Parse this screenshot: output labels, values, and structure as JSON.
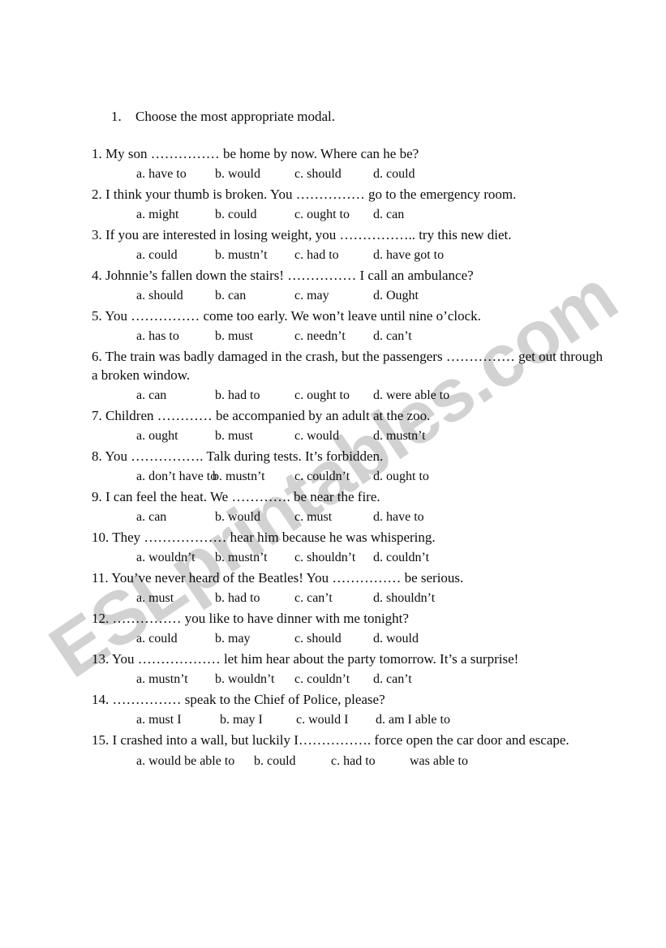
{
  "document": {
    "instruction_number": "1.",
    "instruction_text": "Choose the most appropriate modal.",
    "watermark": "ESLprintables.com",
    "watermark_color": "#d2d2d2",
    "text_color": "#0d0d0d",
    "background_color": "#ffffff"
  },
  "questions": [
    {
      "number": "1.",
      "text": "1. My son …………… be home by now. Where can he be?",
      "options": [
        "a. have to",
        "b. would",
        "c. should",
        "d. could"
      ]
    },
    {
      "number": "2.",
      "text": "2. I think your thumb is broken. You …………… go to the emergency room.",
      "options": [
        "a. might",
        "b. could",
        "c. ought to",
        "d. can"
      ]
    },
    {
      "number": "3.",
      "text": "3. If you are interested in losing weight, you …………….. try this new diet.",
      "options": [
        "a. could",
        "b. mustn’t",
        "c. had to",
        "d. have got to"
      ]
    },
    {
      "number": "4.",
      "text": "4. Johnnie’s fallen down the stairs! …………… I call an ambulance?",
      "options": [
        "a. should",
        "b. can",
        "c. may",
        "d. Ought"
      ]
    },
    {
      "number": "5.",
      "text": "5. You …………… come too early. We won’t leave until nine o’clock.",
      "options": [
        "a. has to",
        "b. must",
        "c. needn’t",
        "d. can’t"
      ]
    },
    {
      "number": "6.",
      "text": "6. The train was badly damaged in the crash, but the passengers …………… get out through a broken window.",
      "options": [
        "a. can",
        "b. had to",
        "c. ought to",
        "d. were able to"
      ]
    },
    {
      "number": "7.",
      "text": "7. Children ………… be accompanied by an adult at the zoo.",
      "options": [
        "a. ought",
        "b. must",
        "c. would",
        "d. mustn’t"
      ]
    },
    {
      "number": "8.",
      "text": "8. You ……………. Talk during tests. It’s forbidden.",
      "options": [
        "a. don’t have to",
        "b. mustn’t",
        "c. couldn’t",
        "d. ought to"
      ]
    },
    {
      "number": "9.",
      "text": "9. I can feel the heat. We …………. be near the fire.",
      "options": [
        "a. can",
        "b. would",
        "c. must",
        "d. have to"
      ]
    },
    {
      "number": "10.",
      "text": "10. They ……………… hear him because he was whispering.",
      "options": [
        "a. wouldn’t",
        "b. mustn’t",
        "c. shouldn’t",
        "d. couldn’t"
      ]
    },
    {
      "number": "11.",
      "text": "11. You’ve never heard of the Beatles! You …………… be serious.",
      "options": [
        "a. must",
        "b. had to",
        "c. can’t",
        "d. shouldn’t"
      ]
    },
    {
      "number": "12.",
      "text": "12. …………… you like to have dinner with me tonight?",
      "options": [
        "a. could",
        "b. may",
        "c. should",
        "d. would"
      ]
    },
    {
      "number": "13.",
      "text": "13. You ……………… let him hear about the party tomorrow. It’s a surprise!",
      "options": [
        "a. mustn’t",
        "b. wouldn’t",
        "c. couldn’t",
        "d. can’t"
      ]
    },
    {
      "number": "14.",
      "text": "14. …………… speak to the Chief of Police, please?",
      "options": [
        "a. must I",
        "b. may I",
        "c. would I",
        "d. am I able to"
      ]
    },
    {
      "number": "15.",
      "text": "15. I crashed into a wall, but luckily I……………. force open the car door and escape.",
      "options": [
        "a. would be able to",
        "b. could",
        "c. had to",
        "was able to"
      ]
    }
  ]
}
